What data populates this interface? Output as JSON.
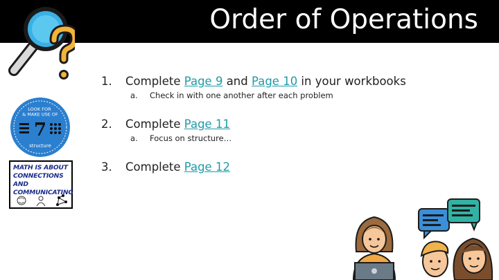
{
  "slide": {
    "title": "Order of Operations"
  },
  "badge": {
    "top_text": "LOOK FOR & MAKE USE OF",
    "number": "7",
    "bottom_text": "structure"
  },
  "math_card": {
    "text": "MATH IS ABOUT CONNECTIONS AND COMMUNICATING"
  },
  "tasks": [
    {
      "number": "1.",
      "prefix": "Complete ",
      "link1": "Page 9",
      "middle": " and ",
      "link2": "Page 10",
      "suffix": " in your workbooks",
      "sub": {
        "number": "a.",
        "text": "Check in with one another after each problem"
      }
    },
    {
      "number": "2.",
      "prefix": "Complete ",
      "link1": "Page 11",
      "sub": {
        "number": "a.",
        "text": "Focus on structure…"
      }
    },
    {
      "number": "3.",
      "prefix": "Complete ",
      "link1": "Page 12"
    }
  ],
  "colors": {
    "title_bar": "#000000",
    "link": "#1f9aa8",
    "badge": "#2b7fcf",
    "chat_bubble": "#3a8fd9",
    "chat_bubble_alt": "#2fb3a5"
  }
}
